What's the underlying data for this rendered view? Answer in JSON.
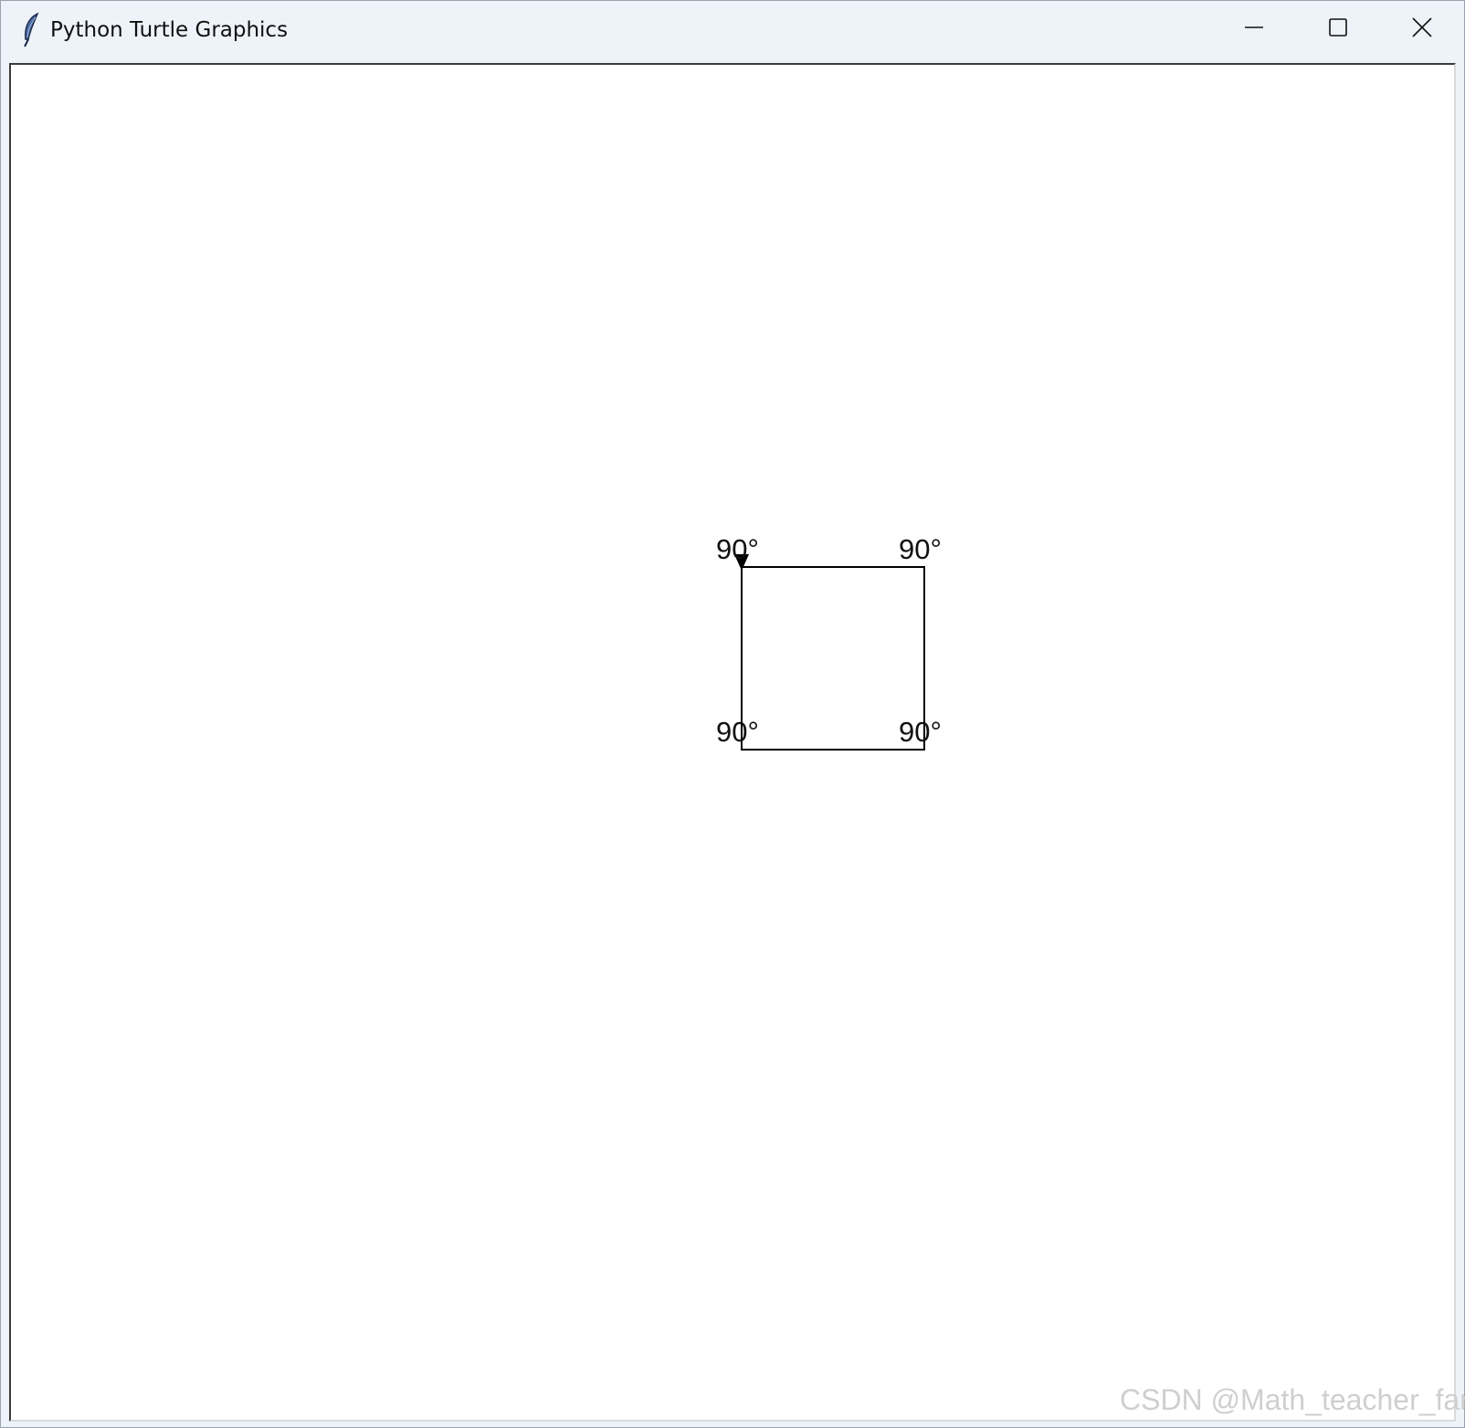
{
  "window": {
    "title": "Python Turtle Graphics",
    "app_icon": "feather-icon",
    "controls": {
      "minimize_icon": "minimize-icon",
      "maximize_icon": "maximize-icon",
      "close_icon": "close-icon"
    }
  },
  "canvas": {
    "shape": "square",
    "corner_labels": [
      "90°",
      "90°",
      "90°",
      "90°"
    ],
    "turtle_icon": "turtle-arrow-icon",
    "stroke_color": "#000000",
    "background_color": "#ffffff"
  },
  "watermark": {
    "text": "CSDN @Math_teacher_fan"
  }
}
